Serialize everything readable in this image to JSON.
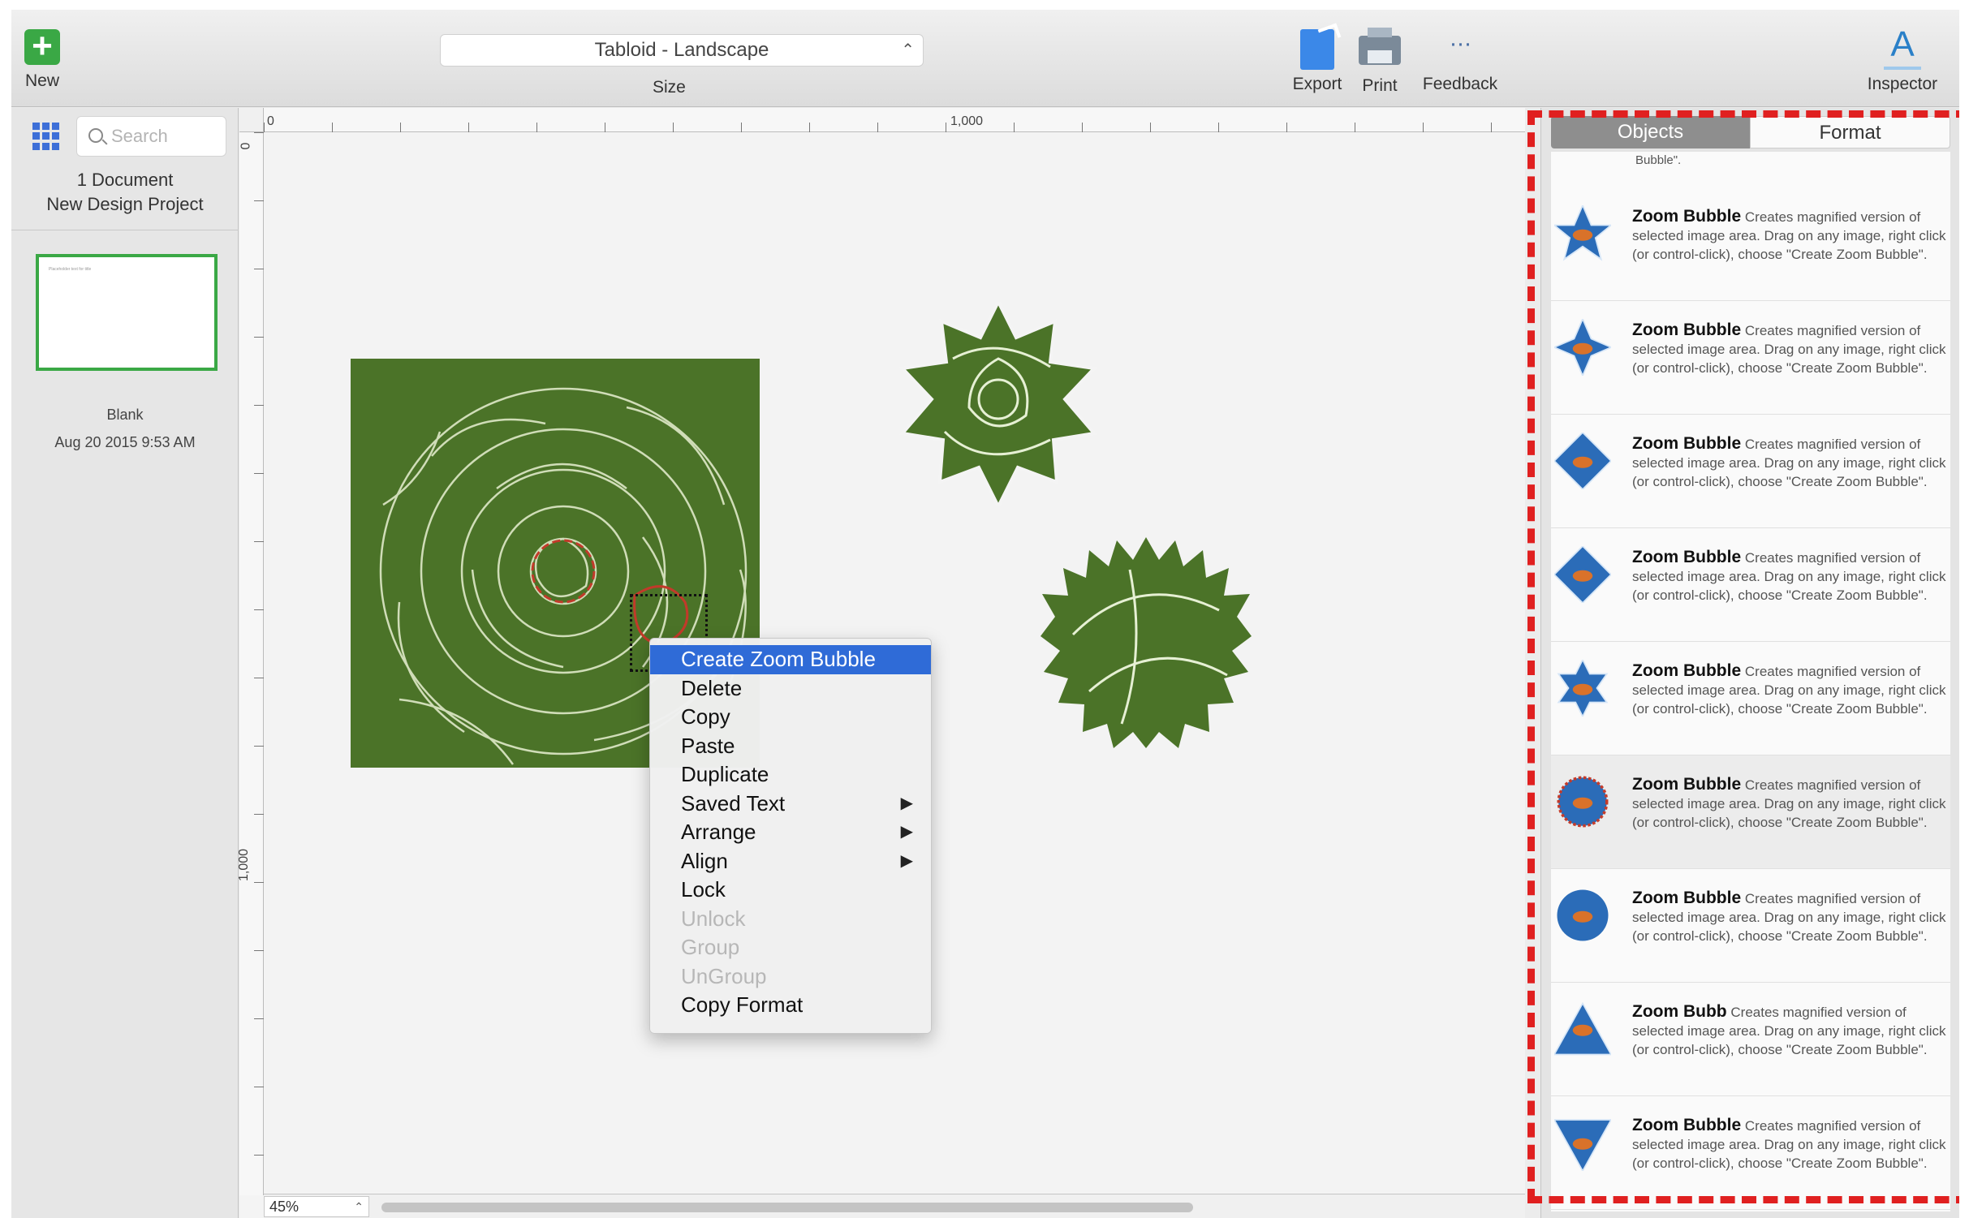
{
  "toolbar": {
    "new_label": "New",
    "size_value": "Tabloid - Landscape",
    "size_label": "Size",
    "export_label": "Export",
    "print_label": "Print",
    "feedback_label": "Feedback",
    "inspector_label": "Inspector",
    "inspector_glyph": "A",
    "feedback_glyph": "···",
    "new_glyph": "+"
  },
  "sidebar": {
    "search_placeholder": "Search",
    "doc_count": "1 Document",
    "project_name": "New Design Project",
    "thumbnail": {
      "placeholder_text": "Placeholder text for title",
      "name": "Blank",
      "date": "Aug 20 2015 9:53 AM"
    }
  },
  "canvas": {
    "ruler_top_labels": [
      "0",
      "1,000"
    ],
    "ruler_left_labels": [
      "0",
      "1,000"
    ],
    "zoom": "45%",
    "zoom_arrows": "⌃⌄"
  },
  "context_menu": {
    "items": [
      {
        "label": "Create Zoom Bubble",
        "state": "highlighted",
        "submenu": false
      },
      {
        "label": "Delete",
        "state": "enabled",
        "submenu": false
      },
      {
        "label": "Copy",
        "state": "enabled",
        "submenu": false
      },
      {
        "label": "Paste",
        "state": "enabled",
        "submenu": false
      },
      {
        "label": "Duplicate",
        "state": "enabled",
        "submenu": false
      },
      {
        "label": "Saved Text",
        "state": "enabled",
        "submenu": true
      },
      {
        "label": "Arrange",
        "state": "enabled",
        "submenu": true
      },
      {
        "label": "Align",
        "state": "enabled",
        "submenu": true
      },
      {
        "label": "Lock",
        "state": "enabled",
        "submenu": false
      },
      {
        "label": "Unlock",
        "state": "disabled",
        "submenu": false
      },
      {
        "label": "Group",
        "state": "disabled",
        "submenu": false
      },
      {
        "label": "UnGroup",
        "state": "disabled",
        "submenu": false
      },
      {
        "label": "Copy Format",
        "state": "enabled",
        "submenu": false
      }
    ],
    "submenu_arrow": "▶"
  },
  "right_panel": {
    "tabs": [
      {
        "label": "Objects",
        "active": true
      },
      {
        "label": "Format",
        "active": false
      }
    ],
    "list_head": "Bubble\".",
    "items": [
      {
        "title": "Zoom Bubble",
        "desc": "Creates magnified version of selected image area.  Drag on any image, right click (or control-click), choose \"Create Zoom Bubble\".",
        "shape": "star-5",
        "selected": false
      },
      {
        "title": "Zoom Bubble",
        "desc": "Creates magnified version of selected image area.  Drag on any image, right click (or control-click), choose \"Create Zoom Bubble\".",
        "shape": "star-4",
        "selected": false
      },
      {
        "title": "Zoom Bubble",
        "desc": "Creates magnified version of selected image area.  Drag on any image, right click (or control-click), choose \"Create Zoom Bubble\".",
        "shape": "diamond",
        "selected": false
      },
      {
        "title": "Zoom Bubble",
        "desc": "Creates magnified version of selected image area.  Drag on any image, right click (or control-click), choose \"Create Zoom Bubble\".",
        "shape": "diamond",
        "selected": false
      },
      {
        "title": "Zoom Bubble",
        "desc": "Creates magnified version of selected image area.  Drag on any image, right click (or control-click), choose \"Create Zoom Bubble\".",
        "shape": "star-6",
        "selected": false
      },
      {
        "title": "Zoom Bubble",
        "desc": "Creates magnified version of selected image area.  Drag on any image, right click (or control-click), choose \"Create Zoom Bubble\".",
        "shape": "circle-badge",
        "selected": true
      },
      {
        "title": "Zoom Bubble",
        "desc": "Creates magnified version of selected image area.  Drag on any image, right click (or control-click), choose \"Create Zoom Bubble\".",
        "shape": "circle",
        "selected": false
      },
      {
        "title": "Zoom Bubb",
        "desc": "Creates magnified version of selected image area.  Drag on any image, right click (or control-click), choose \"Create Zoom Bubble\".",
        "shape": "triangle",
        "selected": false
      },
      {
        "title": "Zoom Bubble",
        "desc": "Creates magnified version of selected image area.  Drag on any image, right click (or control-click), choose \"Create Zoom Bubble\".",
        "shape": "triangle-down",
        "selected": false
      }
    ]
  },
  "colors": {
    "accent_green": "#3aa845",
    "menu_highlight": "#2f6bd7",
    "image_green": "#4b7328",
    "annotation_red": "#e02020",
    "bubble_blue": "#2b6cb8"
  }
}
